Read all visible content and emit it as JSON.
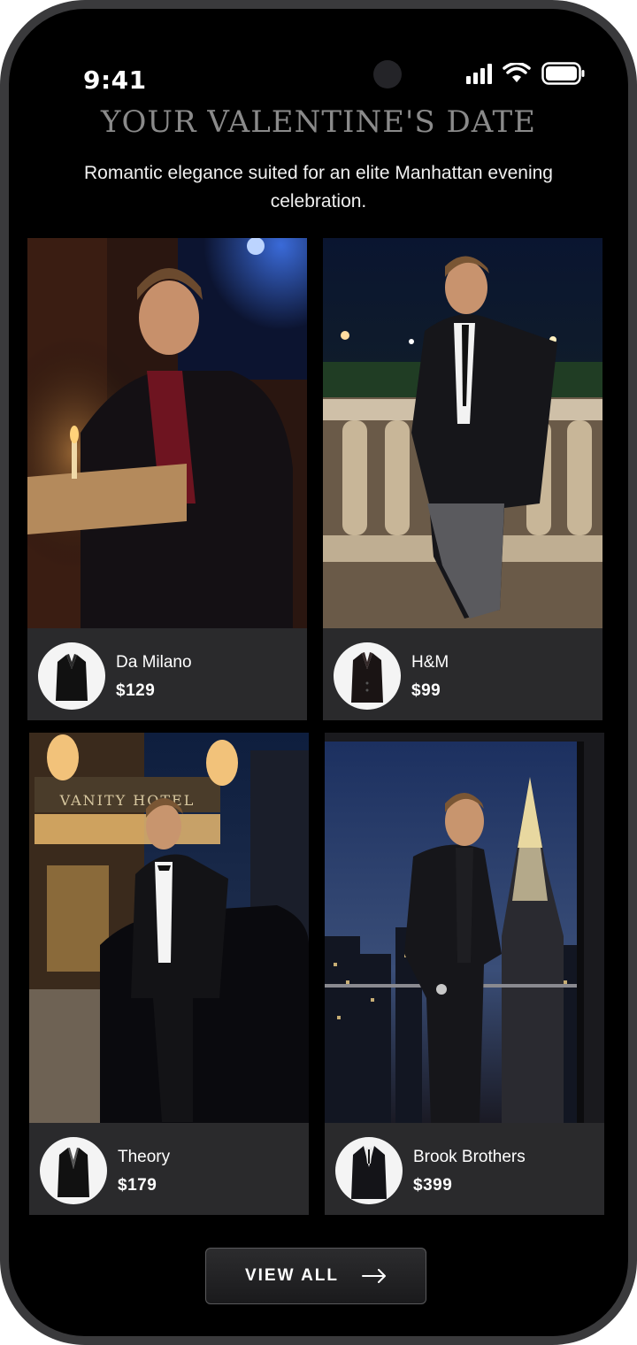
{
  "status_bar": {
    "time": "9:41"
  },
  "header": {
    "title": "YOUR VALENTINE'S DATE",
    "subtitle": "Romantic elegance suited for an elite Manhattan evening celebration."
  },
  "outfits": [
    {
      "brand": "Da Milano",
      "price": "$129",
      "photo": "candlelit-jazz-bar-photo",
      "thumb": "velvet-blazer-thumbnail"
    },
    {
      "brand": "H&M",
      "price": "$99",
      "photo": "central-park-balustrade-photo",
      "thumb": "velvet-blazer-thumbnail"
    },
    {
      "brand": "Theory",
      "price": "$179",
      "photo": "hotel-entrance-limousine-photo",
      "thumb": "tuxedo-jacket-thumbnail"
    },
    {
      "brand": "Brook Brothers",
      "price": "$399",
      "photo": "chrysler-building-view-photo",
      "thumb": "black-suit-thumbnail"
    }
  ],
  "hotel_sign": "VANITY HOTEL",
  "cta": {
    "label": "VIEW ALL"
  },
  "colors": {
    "background": "#000000",
    "card": "#2a2a2c",
    "title": "#8a8a8a",
    "text": "#ffffff"
  }
}
